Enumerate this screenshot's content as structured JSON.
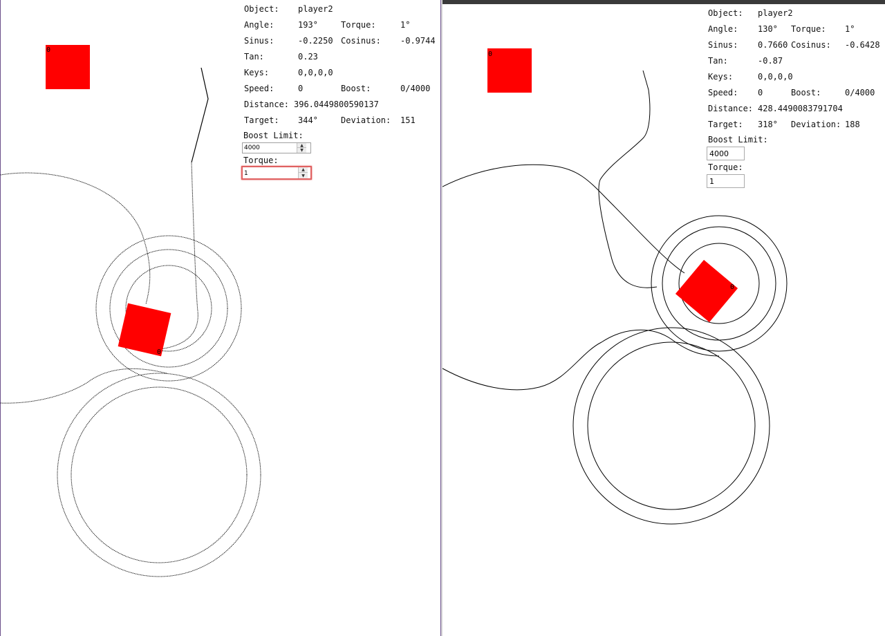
{
  "left": {
    "hud": {
      "object_label": "Object:",
      "object_value": "player2",
      "angle_label": "Angle:",
      "angle_value": "193°",
      "torque_label": "Torque:",
      "torque_value": "1°",
      "sinus_label": "Sinus:",
      "sinus_value": "-0.2250",
      "cosinus_label": "Cosinus:",
      "cosinus_value": "-0.9744",
      "tan_label": "Tan:",
      "tan_value": "0.23",
      "keys_label": "Keys:",
      "keys_value": "0,0,0,0",
      "speed_label": "Speed:",
      "speed_value": "0",
      "boost_label": "Boost:",
      "boost_value": "0/4000",
      "distance_label": "Distance:",
      "distance_value": "396.0449800590137",
      "target_label": "Target:",
      "target_value": "344°",
      "deviation_label": "Deviation:",
      "deviation_value": "151"
    },
    "controls": {
      "boost_limit_label": "Boost Limit:",
      "boost_limit_value": "4000",
      "torque_label": "Torque:",
      "torque_value": "1"
    },
    "objects": {
      "target_marker_label": "0",
      "player_marker_label": "0"
    }
  },
  "right": {
    "hud": {
      "object_label": "Object:",
      "object_value": "player2",
      "angle_label": "Angle:",
      "angle_value": "130°",
      "torque_label": "Torque:",
      "torque_value": "1°",
      "sinus_label": "Sinus:",
      "sinus_value": "0.7660",
      "cosinus_label": "Cosinus:",
      "cosinus_value": "-0.6428",
      "tan_label": "Tan:",
      "tan_value": "-0.87",
      "keys_label": "Keys:",
      "keys_value": "0,0,0,0",
      "speed_label": "Speed:",
      "speed_value": "0",
      "boost_label": "Boost:",
      "boost_value": "0/4000",
      "distance_label": "Distance:",
      "distance_value": "428.4490083791704",
      "target_label": "Target:",
      "target_value": "318°",
      "deviation_label": "Deviation:",
      "deviation_value": "188"
    },
    "controls": {
      "boost_limit_label": "Boost Limit:",
      "boost_limit_value": "4000",
      "torque_label": "Torque:",
      "torque_value": "1"
    },
    "objects": {
      "target_marker_label": "0",
      "player_marker_label": "0"
    }
  },
  "colors": {
    "object_fill": "#ff0000",
    "path_stroke": "#000000",
    "invalid_border": "#e06060"
  }
}
